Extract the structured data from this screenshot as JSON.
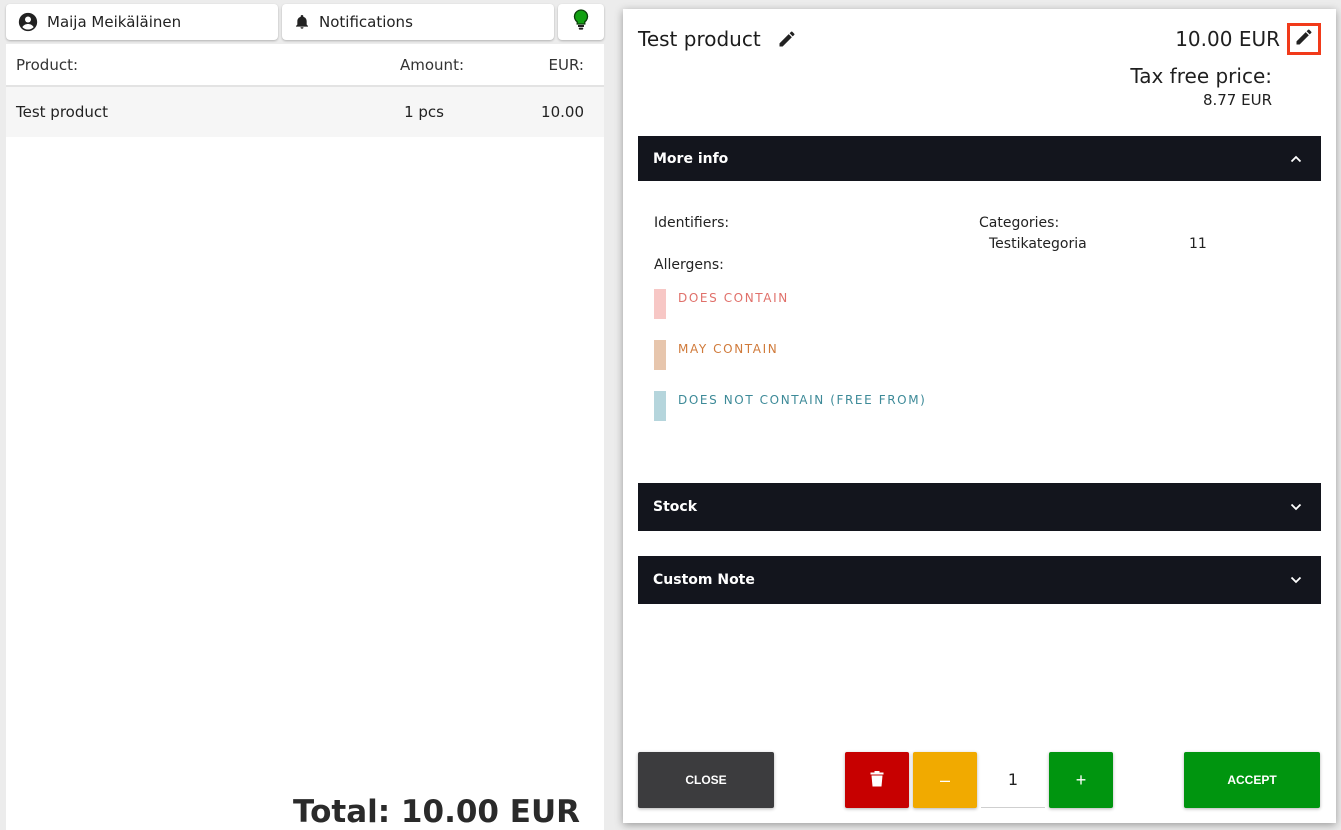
{
  "topbar": {
    "user_name": "Maija Meikäläinen",
    "notifications_label": "Notifications",
    "bulb_color": "#12a012"
  },
  "cart": {
    "headers": {
      "product": "Product:",
      "amount": "Amount:",
      "eur": "EUR:"
    },
    "rows": [
      {
        "product": "Test product",
        "amount": "1 pcs",
        "eur": "10.00"
      }
    ],
    "total": "Total: 10.00 EUR"
  },
  "modal": {
    "product_name": "Test product",
    "price": "10.00 EUR",
    "tax_free_label": "Tax free price:",
    "tax_free_value": "8.77 EUR",
    "more_info": {
      "title": "More info",
      "identifiers_label": "Identifiers:",
      "categories_label": "Categories:",
      "category_name": "Testikategoria",
      "category_value": "11",
      "allergens_label": "Allergens:",
      "allergens": [
        {
          "label": "DOES CONTAIN",
          "swatch": "#f7c7c5",
          "color": "#e0706a"
        },
        {
          "label": "MAY CONTAIN",
          "swatch": "#e7c6ad",
          "color": "#d07a3a"
        },
        {
          "label": "DOES NOT CONTAIN (FREE FROM)",
          "swatch": "#b5d5dc",
          "color": "#3d8a98"
        }
      ]
    },
    "stock_title": "Stock",
    "custom_note_title": "Custom Note",
    "buttons": {
      "close": "CLOSE",
      "accept": "ACCEPT",
      "plus": "+",
      "minus": "–"
    },
    "quantity": "1"
  }
}
